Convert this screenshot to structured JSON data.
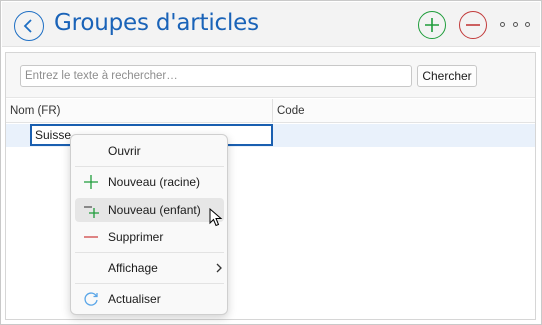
{
  "header": {
    "title": "Groupes d'articles",
    "icons": {
      "back": "back-arrow-icon",
      "add": "plus-circle-icon",
      "remove": "minus-circle-icon",
      "more": "more-options-icon"
    }
  },
  "search": {
    "placeholder": "Entrez le texte à rechercher…",
    "value": "",
    "button_label": "Chercher"
  },
  "grid": {
    "columns": [
      "Nom (FR)",
      "Code"
    ],
    "rows": [
      {
        "name": "Suisse",
        "code": ""
      }
    ]
  },
  "context_menu": {
    "items": [
      {
        "label": "Ouvrir",
        "icon": ""
      },
      {
        "label": "Nouveau (racine)",
        "icon": "plus-icon"
      },
      {
        "label": "Nouveau (enfant)",
        "icon": "add-child-icon",
        "hovered": true
      },
      {
        "label": "Supprimer",
        "icon": "minus-icon"
      },
      {
        "label": "Affichage",
        "icon": "",
        "submenu": true
      },
      {
        "label": "Actualiser",
        "icon": "refresh-icon"
      }
    ]
  },
  "colors": {
    "accent_blue": "#1a63b8",
    "add_green": "#1f9d3b",
    "remove_red": "#c23b3b",
    "selection": "#e9f1fb"
  }
}
